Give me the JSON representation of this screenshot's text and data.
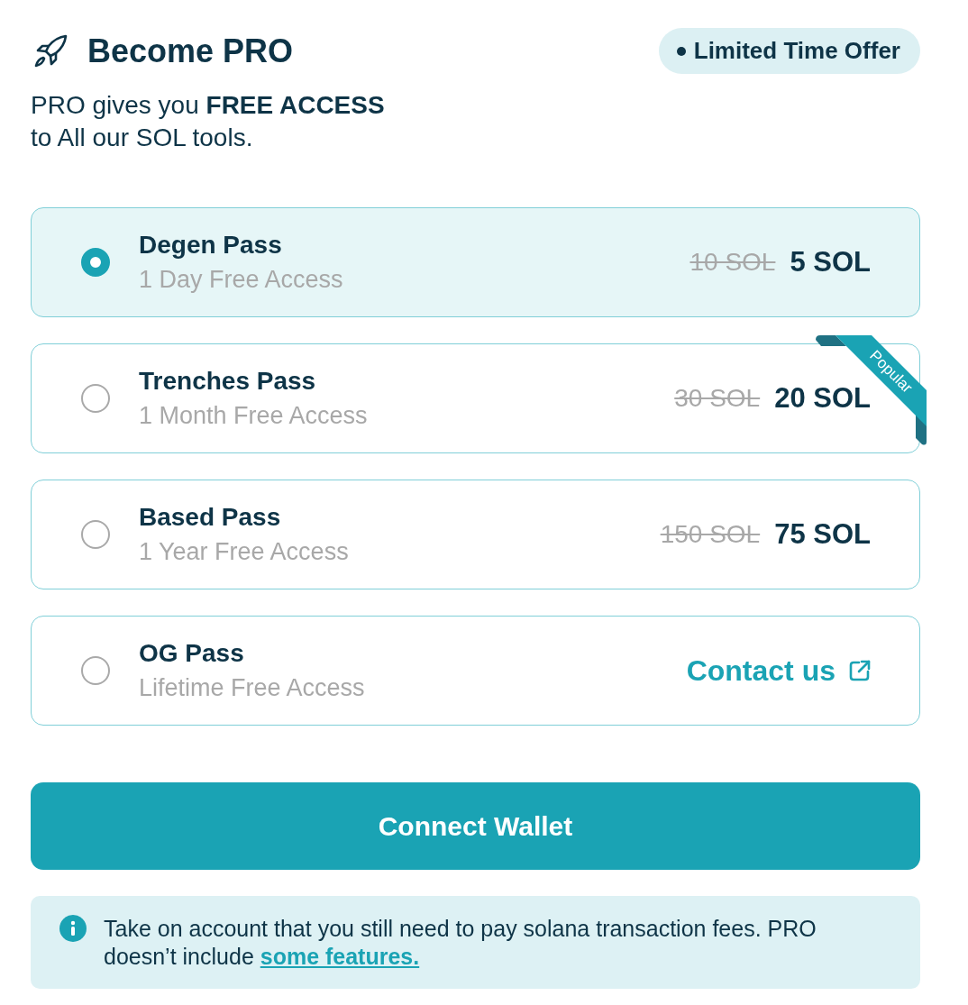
{
  "header": {
    "title": "Become PRO",
    "badge": "Limited Time Offer"
  },
  "intro": "PRO gives you **FREE ACCESS**\nto All our SOL tools.",
  "plans": [
    {
      "kind": "price",
      "name": "Degen Pass",
      "subtitle": "1 Day Free Access",
      "selected": true,
      "old_price": "10 SOL",
      "price": "5 SOL"
    },
    {
      "kind": "price",
      "name": "Trenches Pass",
      "subtitle": "1 Month Free Access",
      "selected": false,
      "old_price": "30 SOL",
      "price": "20 SOL",
      "ribbon": "Popular"
    },
    {
      "kind": "price",
      "name": "Based Pass",
      "subtitle": "1 Year Free Access",
      "selected": false,
      "old_price": "150 SOL",
      "price": "75 SOL"
    },
    {
      "kind": "contact",
      "name": "OG Pass",
      "subtitle": "Lifetime Free Access",
      "selected": false,
      "link": "Contact us"
    }
  ],
  "connect_button": "Connect Wallet",
  "notice": {
    "text": "Take on account that you still need to pay solana transaction fees. PRO doesn’t include",
    "link": "some features."
  }
}
